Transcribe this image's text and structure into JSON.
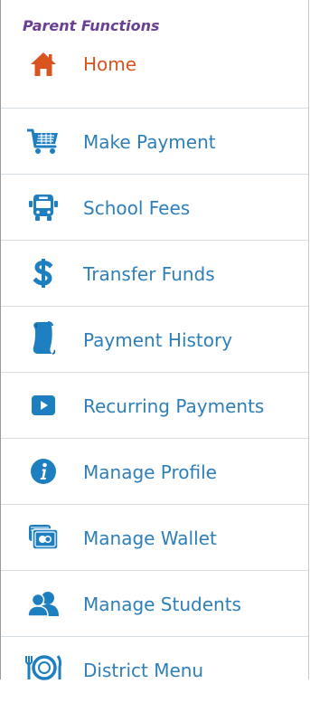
{
  "panel": {
    "title": "Parent Functions",
    "items": [
      {
        "label": "Home",
        "icon": "home-icon"
      },
      {
        "label": "Make Payment",
        "icon": "shopping-cart-icon"
      },
      {
        "label": "School Fees",
        "icon": "school-bus-icon"
      },
      {
        "label": "Transfer Funds",
        "icon": "dollar-icon"
      },
      {
        "label": "Payment History",
        "icon": "scroll-icon"
      },
      {
        "label": "Recurring Payments",
        "icon": "play-icon"
      },
      {
        "label": "Manage Profile",
        "icon": "info-icon"
      },
      {
        "label": "Manage Wallet",
        "icon": "wallet-icon"
      },
      {
        "label": "Manage Students",
        "icon": "users-icon"
      },
      {
        "label": "District Menu",
        "icon": "plate-icon"
      }
    ]
  },
  "colors": {
    "title": "#6b3f93",
    "home": "#d9541e",
    "link": "#2e7fb8",
    "icon": "#1e7fc0",
    "separator": "#d6dee4"
  }
}
